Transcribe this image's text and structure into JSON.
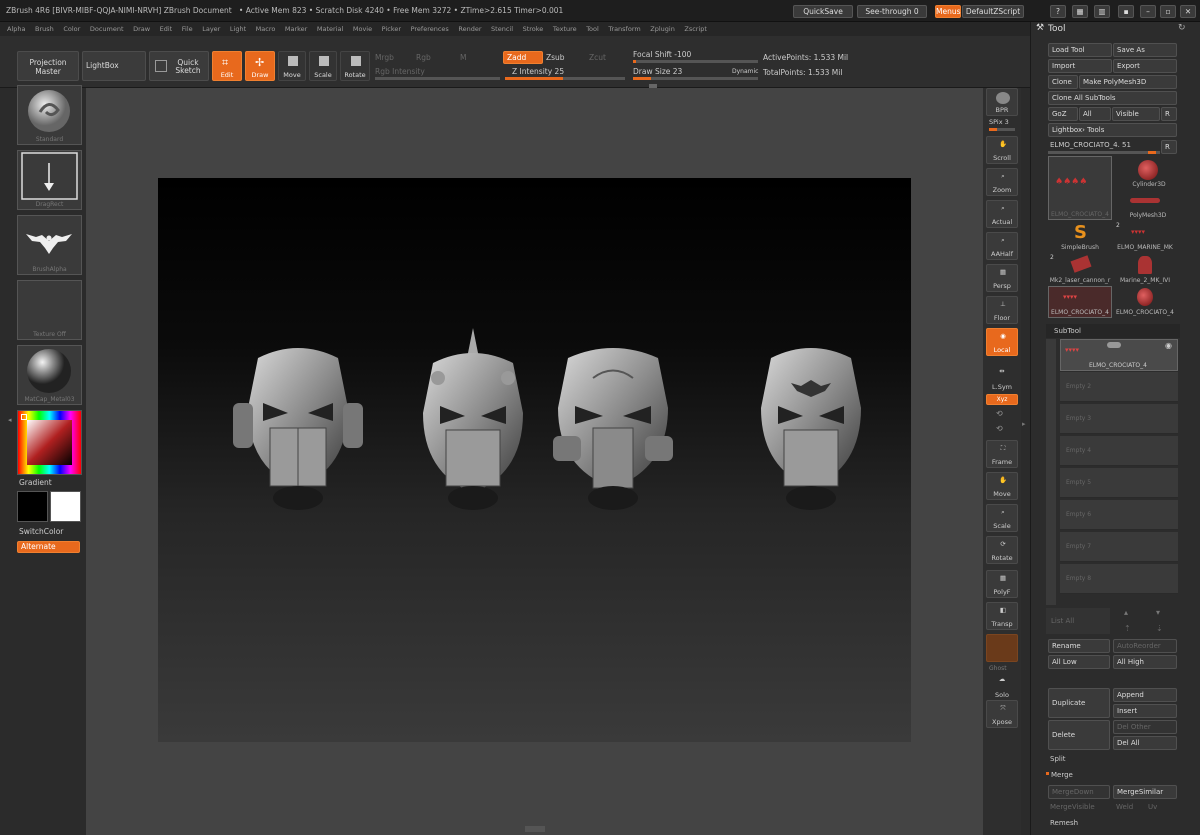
{
  "window": {
    "title": "ZBrush 4R6 [BIVR-MIBF-QQJA-NIMI-NRVH]   ZBrush Document",
    "status": "• Active Mem 823 • Scratch Disk 4240 • Free Mem 3272 • ZTime>2.615 Timer>0.001",
    "quicksave": "QuickSave",
    "see_through": "See-through  0",
    "menus": "Menus",
    "default_zscript": "DefaultZScript"
  },
  "menu": [
    "Alpha",
    "Brush",
    "Color",
    "Document",
    "Draw",
    "Edit",
    "File",
    "Layer",
    "Light",
    "Macro",
    "Marker",
    "Material",
    "Movie",
    "Picker",
    "Preferences",
    "Render",
    "Stencil",
    "Stroke",
    "Texture",
    "Tool",
    "Transform",
    "Zplugin",
    "Zscript"
  ],
  "shelf": {
    "projection_master": "Projection Master",
    "lightbox": "LightBox",
    "quick_sketch": "Quick Sketch",
    "edit": "Edit",
    "draw": "Draw",
    "move": "Move",
    "scale": "Scale",
    "rotate": "Rotate",
    "mrgb": "Mrgb",
    "rgb": "Rgb",
    "m": "M",
    "rgb_intensity": "Rgb Intensity",
    "zadd": "Zadd",
    "zsub": "Zsub",
    "zcut": "Zcut",
    "z_intensity": "Z Intensity 25",
    "focal_shift": "Focal Shift -100",
    "draw_size": "Draw Size 23",
    "dynamic": "Dynamic",
    "active_points": "ActivePoints: 1.533 Mil",
    "total_points": "TotalPoints: 1.533 Mil"
  },
  "left": {
    "brush": "Standard",
    "stroke": "DragRect",
    "alpha": "BrushAlpha",
    "texture": "Texture Off",
    "material": "MatCap_Metal03",
    "gradient": "Gradient",
    "switch_color": "SwitchColor",
    "alternate": "Alternate"
  },
  "right_shelf": [
    "BPR",
    "SPix 3",
    "Scroll",
    "Zoom",
    "Actual",
    "AAHalf",
    "Persp",
    "Floor",
    "Local",
    "L.Sym",
    "Xyz",
    "Frame",
    "Move",
    "Scale",
    "Rotate",
    "PolyF",
    "Transp",
    "Ghost",
    "Solo",
    "Xpose"
  ],
  "tool": {
    "title": "Tool",
    "load_tool": "Load Tool",
    "save_as": "Save As",
    "import": "Import",
    "export": "Export",
    "clone": "Clone",
    "make_polymesh": "Make PolyMesh3D",
    "clone_all": "Clone All SubTools",
    "goz": "GoZ",
    "all": "All",
    "visible": "Visible",
    "r": "R",
    "lightbox_tools": "Lightbox› Tools",
    "current_tool": "ELMO_CROCIATO_4. 51",
    "tools": [
      {
        "name": "ELMO_CROCIATO_4"
      },
      {
        "name": "Cylinder3D"
      },
      {
        "name": "PolyMesh3D"
      },
      {
        "name": "SimpleBrush"
      },
      {
        "name": "ELMO_MARINE_MK"
      },
      {
        "name": "Mk2_laser_cannon_r"
      },
      {
        "name": "Marine_2_MK_IVI"
      },
      {
        "name": "ELMO_CROCIATO_4"
      },
      {
        "name": "ELMO_CROCIATO_4"
      }
    ],
    "badge_2a": "2",
    "badge_2b": "2",
    "subtool": "SubTool",
    "subtool_active": "ELMO_CROCIATO_4",
    "empty_slots": [
      "Empty 2",
      "Empty 3",
      "Empty 4",
      "Empty 5",
      "Empty 6",
      "Empty 7",
      "Empty 8"
    ],
    "list_all": "List All",
    "rename": "Rename",
    "autoreorder": "AutoReorder",
    "all_low": "All Low",
    "all_high": "All High",
    "duplicate": "Duplicate",
    "append": "Append",
    "insert": "Insert",
    "delete": "Delete",
    "del_other": "Del Other",
    "del_all": "Del All",
    "split": "Split",
    "merge": "Merge",
    "mergedown": "MergeDown",
    "mergesimilar": "MergeSimilar",
    "mergevisible": "MergeVisible",
    "weld": "Weld",
    "uv": "Uv",
    "remesh": "Remesh"
  },
  "colors": {
    "accent": "#e8691d",
    "panel": "#2c2c2c",
    "metal": "#9a9a9a"
  }
}
